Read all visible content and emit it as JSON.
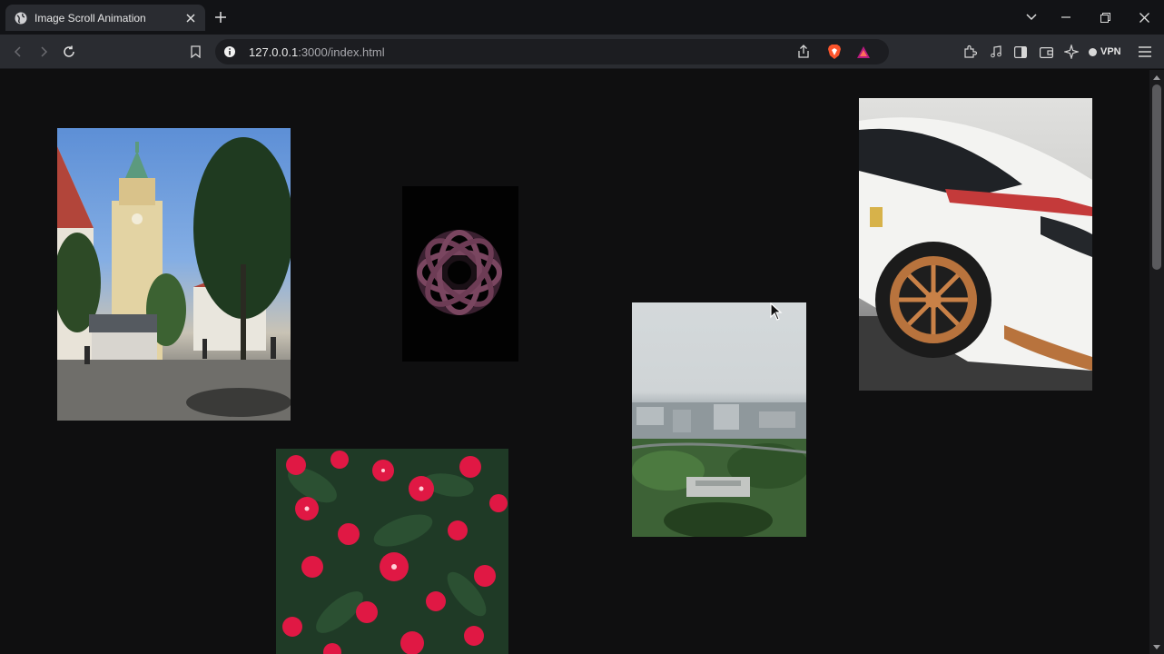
{
  "tab": {
    "title": "Image Scroll Animation",
    "favicon": "globe-icon"
  },
  "window_controls": [
    "chevron-down-icon",
    "minimize-icon",
    "restore-icon",
    "close-icon"
  ],
  "toolbar": {
    "url_host": "127.0.0.1",
    "url_path": ":3000/index.html",
    "vpn_label": "VPN"
  },
  "colors": {
    "page_background": "#0f0f10",
    "toolbar": "#2a2c31",
    "titlebar": "#121316",
    "brave_orange": "#fb542b",
    "rewards_triangle": "#b81a7e"
  },
  "photos": [
    {
      "name": "photo-cathedral-street"
    },
    {
      "name": "photo-dark-rose"
    },
    {
      "name": "photo-city-aerial"
    },
    {
      "name": "photo-white-race-car"
    },
    {
      "name": "photo-red-flowers"
    }
  ]
}
